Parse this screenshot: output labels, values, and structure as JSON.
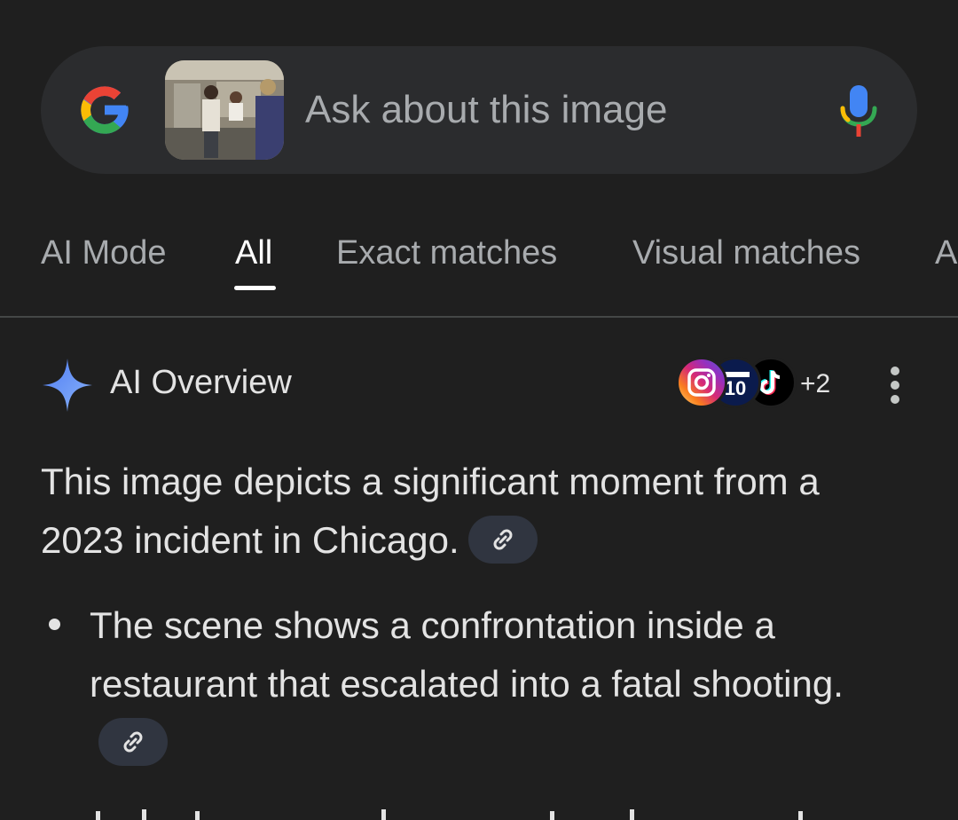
{
  "search": {
    "placeholder": "Ask about this image",
    "logo_icon": "google-g-icon",
    "mic_icon": "microphone-icon"
  },
  "tabs": [
    {
      "label": "AI Mode",
      "active": false
    },
    {
      "label": "All",
      "active": true
    },
    {
      "label": "Exact matches",
      "active": false
    },
    {
      "label": "Visual matches",
      "active": false
    },
    {
      "label": "A",
      "active": false
    }
  ],
  "overview": {
    "title": "AI Overview",
    "sources_more": "+2",
    "source_icons": [
      "instagram-icon",
      "fox10-icon",
      "tiktok-icon"
    ],
    "paragraph": "This image depicts a significant moment from a 2023 incident in Chicago.",
    "bullets": [
      "The scene shows a confrontation inside a restaurant that escalated into a fatal shooting."
    ]
  },
  "colors": {
    "background": "#1f1f1f",
    "search_bar": "#2b2c2e",
    "chip": "#303540",
    "active_tab": "#ffffff",
    "inactive_tab": "#a8abae"
  }
}
